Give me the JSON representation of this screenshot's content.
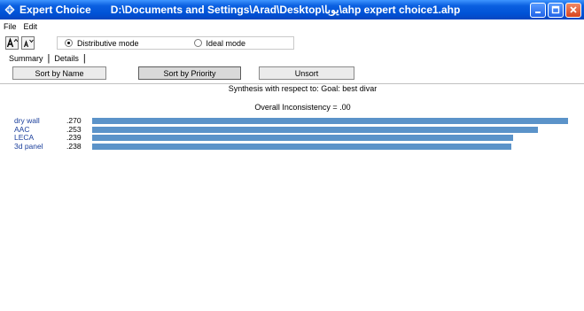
{
  "window": {
    "app_name": "Expert Choice",
    "path": "D:\\Documents and Settings\\Arad\\Desktop\\ﻳﻮﺑﺎ\\ahp expert choice1.ahp"
  },
  "menu": [
    "File",
    "Edit"
  ],
  "toolbar": {
    "mode_options": [
      {
        "label": "Distributive mode",
        "selected": true
      },
      {
        "label": "Ideal mode",
        "selected": false
      }
    ]
  },
  "tabs": [
    "Summary",
    "Details"
  ],
  "sort_buttons": [
    "Sort by Name",
    "Sort by Priority",
    "Unsort"
  ],
  "synthesis_title": "Synthesis with respect to: Goal: best divar",
  "inconsistency_text": "Overall Inconsistency = .00",
  "results": [
    {
      "name": "dry wall",
      "value": ".270",
      "priority": 0.27
    },
    {
      "name": "AAC",
      "value": ".253",
      "priority": 0.253
    },
    {
      "name": "LECA",
      "value": ".239",
      "priority": 0.239
    },
    {
      "name": "3d panel",
      "value": ".238",
      "priority": 0.238
    }
  ],
  "colors": {
    "title_bar": "#0052d6",
    "bar_fill": "#5b93c9",
    "label_blue": "#1a3e9b"
  }
}
